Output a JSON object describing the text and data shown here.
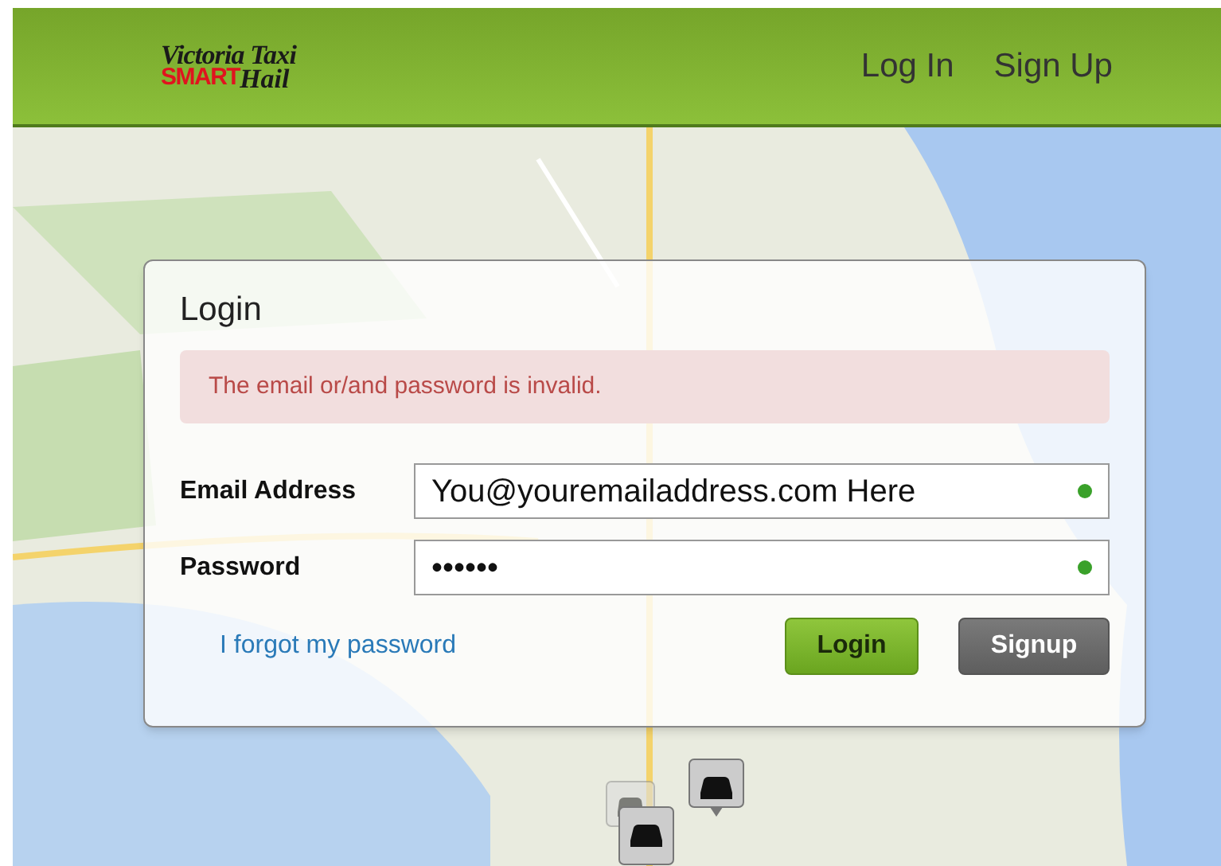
{
  "header": {
    "logo": {
      "line_1": "Victoria Taxi",
      "line_2_red": "SMART",
      "line_2_dark": "Hail"
    },
    "nav": [
      {
        "label": "Log In"
      },
      {
        "label": "Sign Up"
      }
    ]
  },
  "login": {
    "title": "Login",
    "error": "The email or/and password is invalid.",
    "fields": [
      {
        "label": "Email Address",
        "value": "You@youremailaddress.com Here",
        "valid": true
      },
      {
        "label": "Password",
        "value": "••••••",
        "valid": true
      }
    ],
    "forgot_link": "I forgot my password",
    "buttons": [
      {
        "label": "Login",
        "kind": "primary"
      },
      {
        "label": "Signup",
        "kind": "secondary"
      }
    ]
  }
}
